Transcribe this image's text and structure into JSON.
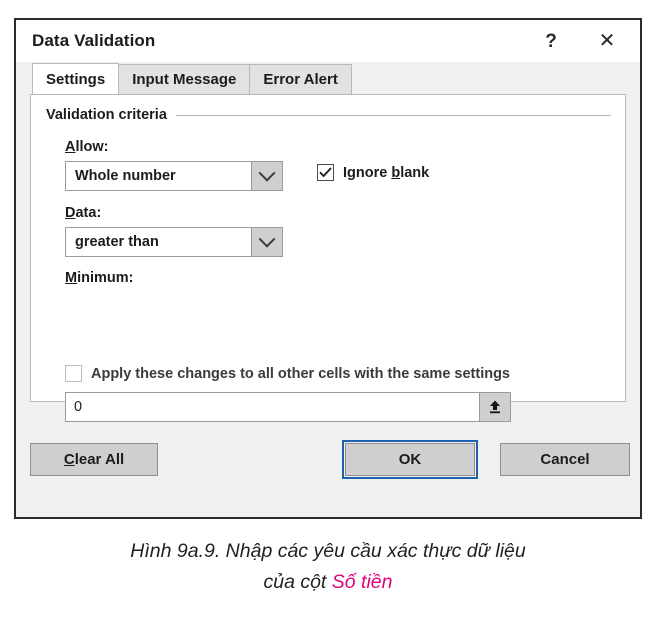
{
  "dialog": {
    "title": "Data Validation",
    "title_buttons": {
      "help_glyph": "?",
      "help_name": "help-icon",
      "close_glyph": "✕",
      "close_name": "close-icon"
    },
    "tabs": [
      {
        "label": "Settings",
        "active": true
      },
      {
        "label": "Input Message",
        "active": false
      },
      {
        "label": "Error Alert",
        "active": false
      }
    ],
    "group": {
      "label": "Validation criteria"
    },
    "fields": {
      "allow": {
        "label_prefix": "",
        "label_accel": "A",
        "label_suffix": "llow:",
        "value": "Whole number",
        "arrow_icon": "chevron-down-icon"
      },
      "data": {
        "label_prefix": "",
        "label_accel": "D",
        "label_suffix": "ata:",
        "value": "greater than",
        "arrow_icon": "chevron-down-icon"
      },
      "minimum": {
        "label_prefix": "",
        "label_accel": "M",
        "label_suffix": "inimum:",
        "value": "0",
        "placeholder": "",
        "picker_icon": "collapse-dialog-up-arrow-icon"
      }
    },
    "checkboxes": {
      "ignore_blank": {
        "checked": true,
        "text_before": "Ignore ",
        "accel": "b",
        "text_after": "lank"
      },
      "apply_changes": {
        "checked": false,
        "label": "Apply these changes to all other cells with the same settings"
      }
    },
    "buttons": {
      "clear_all": {
        "accel": "C",
        "text_after": "lear All"
      },
      "ok": {
        "label": "OK",
        "focused": true
      },
      "cancel": {
        "label": "Cancel"
      }
    }
  },
  "caption": {
    "line1": "Hình 9a.9. Nhập các yêu cầu xác thực dữ liệu",
    "line2_prefix": "của cột ",
    "line2_highlight": "Số tiền",
    "highlight_color": "#e3007c"
  }
}
